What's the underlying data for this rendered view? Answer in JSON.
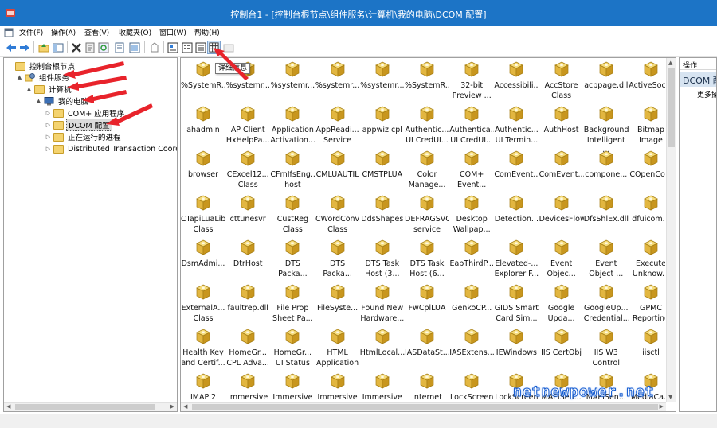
{
  "window": {
    "title": "控制台1 - [控制台根节点\\组件服务\\计算机\\我的电脑\\DCOM 配置]"
  },
  "menu": [
    "文件(F)",
    "操作(A)",
    "查看(V)",
    "收藏夹(O)",
    "窗口(W)",
    "帮助(H)"
  ],
  "toolbar": {
    "tooltip": "详细信息",
    "buttons": [
      "back-arrow-icon",
      "forward-arrow-icon",
      "up-folder-icon",
      "show-tree-icon",
      "delete-icon",
      "properties-icon",
      "refresh-icon",
      "export-icon",
      "help-icon",
      "large-icons-view-icon",
      "small-icons-view-icon",
      "list-view-icon",
      "details-view-icon",
      "disabled-icon"
    ]
  },
  "tree": [
    {
      "label": "控制台根节点",
      "level": 0,
      "expander": "",
      "icon": "folder",
      "selected": false
    },
    {
      "label": "组件服务",
      "level": 1,
      "expander": "▲",
      "icon": "component-services",
      "selected": false
    },
    {
      "label": "计算机",
      "level": 2,
      "expander": "▲",
      "icon": "folder",
      "selected": false
    },
    {
      "label": "我的电脑",
      "level": 3,
      "expander": "▲",
      "icon": "computer",
      "selected": false
    },
    {
      "label": "COM+ 应用程序",
      "level": 4,
      "expander": "▷",
      "icon": "folder",
      "selected": false
    },
    {
      "label": "DCOM 配置",
      "level": 4,
      "expander": "▷",
      "icon": "folder",
      "selected": true
    },
    {
      "label": "正在运行的进程",
      "level": 4,
      "expander": "▷",
      "icon": "folder",
      "selected": false
    },
    {
      "label": "Distributed Transaction Coordin",
      "level": 4,
      "expander": "▷",
      "icon": "folder",
      "selected": false
    }
  ],
  "components": [
    "%SystemR...",
    "%systemr...",
    "%systemr...",
    "%systemr...",
    "%systemr...",
    "%SystemR...",
    "32-bit\nPreview ...",
    "Accessibili...",
    "AccStore\nClass",
    "acppage.dll",
    "ActiveSoc...",
    "ahadmin",
    "AP Client\nHxHelpPa...",
    "Application\nActivation...",
    "AppReadi...\nService",
    "appwiz.cpl",
    "Authentic...\nUI CredUI...",
    "Authentica...\nUI CredUI...",
    "Authentic...\nUI Termin...",
    "AuthHost",
    "Background\nIntelligent ...",
    "Bitmap\nImage",
    "browser",
    "CExcel12...\nClass",
    "CFmIfsEng...\nhost",
    "CMLUAUTIL",
    "CMSTPLUA",
    "Color\nManage...",
    "COM+\nEvent...",
    "ComEvent...",
    "ComEvent...",
    "compone...",
    "COpenCo...",
    "CTapiLuaLib\nClass",
    "cttunesvr",
    "CustReg\nClass",
    "CWordConv\nClass",
    "DdsShapes",
    "DEFRAGSVC\nservice",
    "Desktop\nWallpap...",
    "Detection...",
    "DevicesFlow",
    "DfsShlEx.dll",
    "dfuicom...",
    "DsmAdmi...",
    "DtrHost",
    "DTS\nPacka...",
    "DTS\nPacka...",
    "DTS Task\nHost (3...",
    "DTS Task\nHost (6...",
    "EapThirdP...",
    "Elevated-...\nExplorer F...",
    "Event\nObjec...",
    "Event\nObject ...",
    "Execute\nUnknow...",
    "ExternalA...\nClass",
    "faultrep.dll",
    "File Prop\nSheet Pa...",
    "FileSyste...",
    "Found New\nHardware...",
    "FwCplLUA",
    "GenkoCP...",
    "GIDS Smart\nCard Sim...",
    "Google\nUpda...",
    "GoogleUp...\nCredential...",
    "GPMC\nReporting",
    "Health Key\nand Certif...",
    "HomeGr...\nCPL Adva...",
    "HomeGr...\nUI Status",
    "HTML\nApplication",
    "HtmlLocal...",
    "IASDataSt...",
    "IASExtens...",
    "IEWindows",
    "IIS CertObj",
    "IIS W3\nControl",
    "iisctl",
    "IMAPI2",
    "Immersive",
    "Immersive",
    "Immersive",
    "Immersive",
    "Internet",
    "LockScreen",
    "LockScreen",
    "MAPISen...",
    "MAPISen...",
    "MediaCa..."
  ],
  "actions": {
    "header": "操作",
    "section": "DCOM 配置",
    "more": "更多操作"
  },
  "watermark": "netnewpower.net",
  "colors": {
    "titlebar": "#1c74c6",
    "arrow": "#e8232b",
    "selection": "#dcdcdc",
    "action_section": "#d7e4f1"
  }
}
